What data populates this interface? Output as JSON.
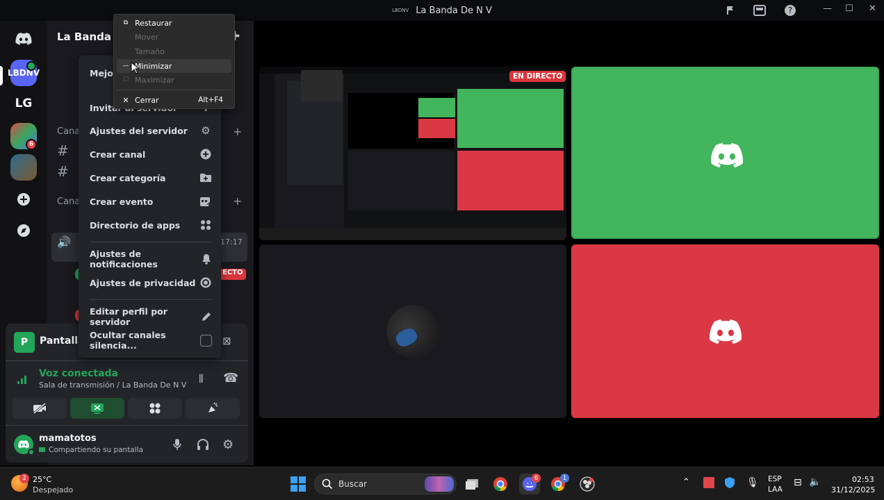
{
  "window": {
    "title": "La Banda De N V",
    "logo_text": "LBDNV"
  },
  "guilds": [
    {
      "label": "LBDNV",
      "badge": ""
    },
    {
      "label": "LG",
      "badge": ""
    },
    {
      "label": "",
      "badge": "6"
    },
    {
      "label": "",
      "badge": ""
    }
  ],
  "sidebar": {
    "server_name": "La Banda De",
    "items": [
      {
        "label": "Mejor"
      },
      {
        "label": "Canal"
      },
      {
        "label": "Canal"
      }
    ],
    "voice_time": "17:17",
    "live_fragment": "ECTO"
  },
  "context_menu": {
    "items": [
      {
        "label": "Invitar al servidor"
      },
      {
        "label": "Ajustes del servidor"
      },
      {
        "label": "Crear canal"
      },
      {
        "label": "Crear categoría"
      },
      {
        "label": "Crear evento"
      },
      {
        "label": "Directorio de apps"
      },
      {
        "label": "Ajustes de notificaciones"
      },
      {
        "label": "Ajustes de privacidad"
      },
      {
        "label": "Editar perfil por servidor"
      },
      {
        "label": "Ocultar canales silencia..."
      }
    ]
  },
  "system_menu": {
    "items": [
      {
        "label": "Restaurar",
        "enabled": true,
        "accel": ""
      },
      {
        "label": "Mover",
        "enabled": false,
        "accel": ""
      },
      {
        "label": "Tamaño",
        "enabled": false,
        "accel": ""
      },
      {
        "label": "Minimizar",
        "enabled": true,
        "accel": ""
      },
      {
        "label": "Maximizar",
        "enabled": false,
        "accel": ""
      },
      {
        "label": "Cerrar",
        "enabled": true,
        "accel": "Alt+F4"
      }
    ]
  },
  "panel": {
    "stream_label": "Pantalla",
    "voice_status": "Voz conectada",
    "voice_channel": "Sala de transmisión / La Banda De N V",
    "username": "mamatotos",
    "user_status": "Compartiendo su pantalla"
  },
  "stage": {
    "live_badge": "EN DIRECTO",
    "colors": {
      "green": "#43b55c",
      "red": "#da3845",
      "dark": "#1a1a1e"
    }
  },
  "taskbar": {
    "weather_temp": "25°C",
    "weather_desc": "Despejado",
    "weather_badge": "2",
    "search_placeholder": "Buscar",
    "discord_badge": "6",
    "chrome_badge": "1",
    "lang": "ESP",
    "layout": "LAA",
    "time": "02:53",
    "date": "31/12/2025"
  }
}
